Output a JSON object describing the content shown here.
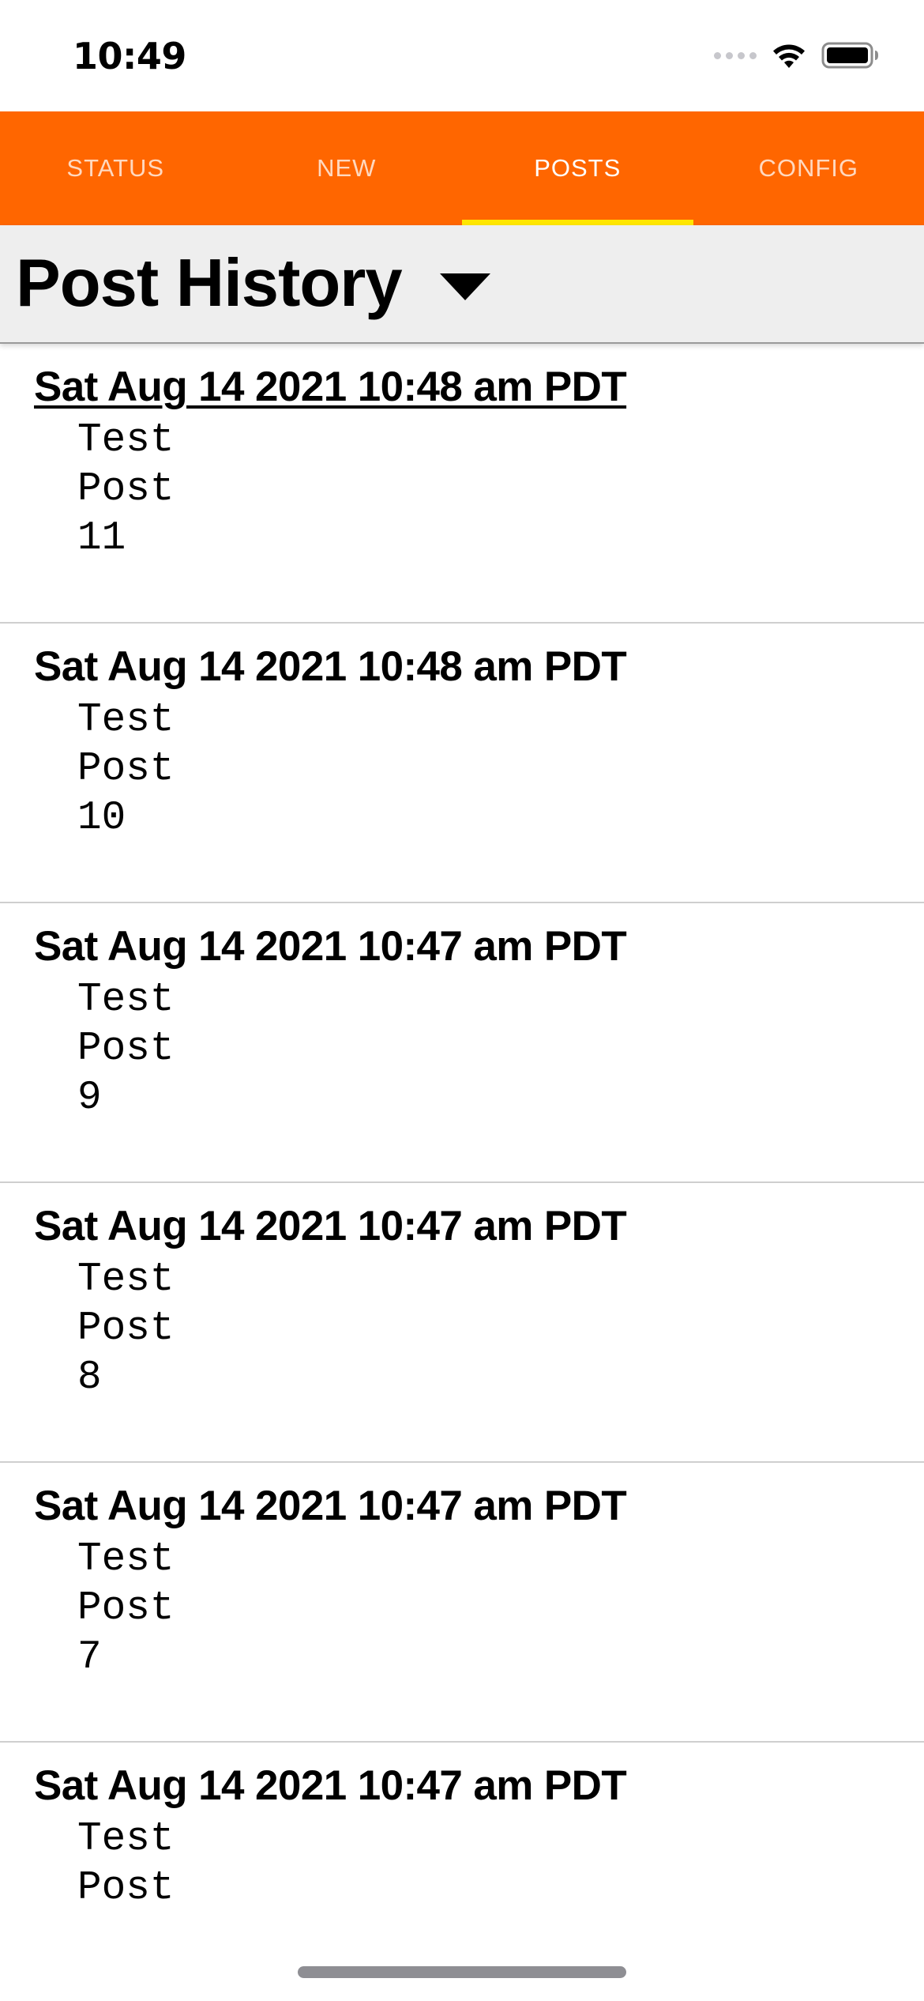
{
  "status_bar": {
    "time": "10:49"
  },
  "tabs": [
    {
      "label": "STATUS",
      "active": false
    },
    {
      "label": "NEW",
      "active": false
    },
    {
      "label": "POSTS",
      "active": true
    },
    {
      "label": "CONFIG",
      "active": false
    }
  ],
  "header": {
    "title": "Post History"
  },
  "posts": [
    {
      "date": "Sat Aug 14 2021 10:48 am PDT",
      "body": "Test Post 11"
    },
    {
      "date": "Sat Aug 14 2021 10:48 am PDT",
      "body": "Test Post 10"
    },
    {
      "date": "Sat Aug 14 2021 10:47 am PDT",
      "body": "Test Post 9"
    },
    {
      "date": "Sat Aug 14 2021 10:47 am PDT",
      "body": "Test Post 8"
    },
    {
      "date": "Sat Aug 14 2021 10:47 am PDT",
      "body": "Test Post 7"
    },
    {
      "date": "Sat Aug 14 2021 10:47 am PDT",
      "body": "Test Post"
    }
  ],
  "colors": {
    "tab_bar": "#ff6600",
    "active_tab_indicator": "#ffe600",
    "header_background": "#eeeeee"
  },
  "icons": [
    "wifi-icon",
    "battery-icon",
    "signal-icon",
    "dropdown-arrow-icon"
  ]
}
